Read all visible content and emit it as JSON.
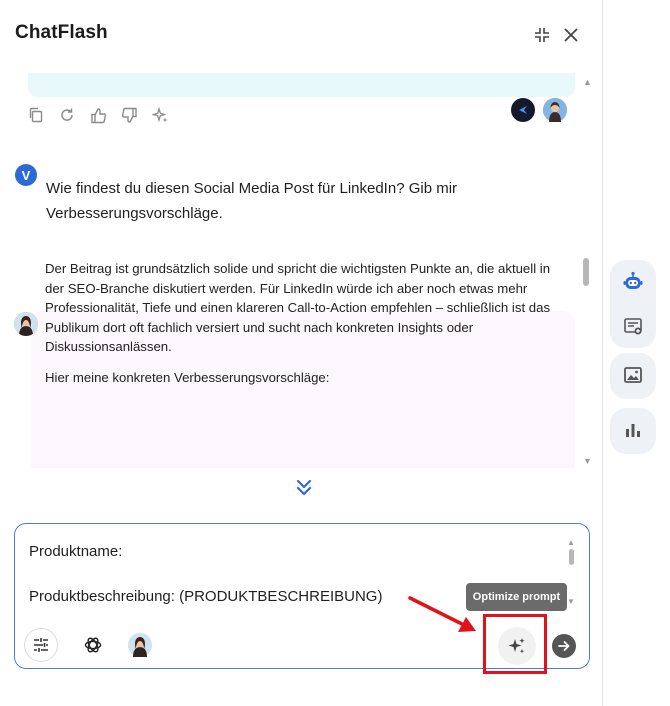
{
  "header": {
    "title": "ChatFlash"
  },
  "conversation": {
    "user_avatar_letter": "V",
    "user_message": "Wie findest du diesen Social Media Post für LinkedIn? Gib mir Verbesserungsvorschläge.",
    "ai_paragraph_1": "Der Beitrag ist grundsätzlich solide und spricht die wichtigsten Punkte an, die aktuell in der SEO-Branche diskutiert werden. Für LinkedIn würde ich aber noch etwas mehr Professionalität, Tiefe und einen klareren Call-to-Action empfehlen – schließlich ist das Publikum dort oft fachlich versiert und sucht nach konkreten Insights oder Diskussionsanlässen.",
    "ai_paragraph_2": "Hier meine konkreten Verbesserungsvorschläge:"
  },
  "composer": {
    "line_1": "Produktname:",
    "line_2": "Produktbeschreibung: (PRODUKTBESCHREIBUNG)",
    "tooltip": "Optimize prompt"
  },
  "icons": {
    "header": [
      "collapse-icon",
      "close-icon"
    ],
    "message_actions": [
      "copy-icon",
      "regenerate-icon",
      "thumbs-up-icon",
      "thumbs-down-icon",
      "sparkle-icon"
    ],
    "composer_tools": [
      "settings-sliders-icon",
      "openai-icon",
      "persona-avatar",
      "sparkle-icon",
      "send-arrow-icon"
    ],
    "rail": [
      "robot-icon",
      "add-note-icon",
      "image-icon",
      "chart-icon"
    ]
  },
  "colors": {
    "accent_blue": "#4c7bd9",
    "highlight_red": "#e0131b",
    "user_avatar": "#2e6ad6",
    "prev_bubble": "#e9f8fb",
    "ai_bubble": "#fbf7fc"
  }
}
